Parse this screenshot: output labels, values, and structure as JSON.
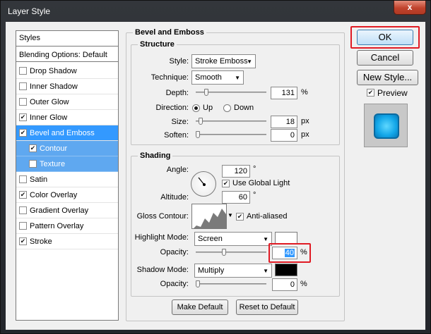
{
  "window": {
    "title": "Layer Style",
    "close_glyph": "x"
  },
  "styles_list": {
    "header": "Styles",
    "blending_options": "Blending Options: Default",
    "items": [
      {
        "label": "Drop Shadow",
        "checked": false
      },
      {
        "label": "Inner Shadow",
        "checked": false
      },
      {
        "label": "Outer Glow",
        "checked": false
      },
      {
        "label": "Inner Glow",
        "checked": true
      },
      {
        "label": "Bevel and Emboss",
        "checked": true,
        "selected": true
      },
      {
        "label": "Contour",
        "checked": true,
        "sub": true
      },
      {
        "label": "Texture",
        "checked": false,
        "sub": true
      },
      {
        "label": "Satin",
        "checked": false
      },
      {
        "label": "Color Overlay",
        "checked": true
      },
      {
        "label": "Gradient Overlay",
        "checked": false
      },
      {
        "label": "Pattern Overlay",
        "checked": false
      },
      {
        "label": "Stroke",
        "checked": true
      }
    ]
  },
  "bevel": {
    "title": "Bevel and Emboss",
    "structure": {
      "legend": "Structure",
      "style_label": "Style:",
      "style_value": "Stroke Emboss",
      "technique_label": "Technique:",
      "technique_value": "Smooth",
      "depth_label": "Depth:",
      "depth_value": "131",
      "depth_unit": "%",
      "direction_label": "Direction:",
      "direction_up": "Up",
      "direction_down": "Down",
      "size_label": "Size:",
      "size_value": "18",
      "size_unit": "px",
      "soften_label": "Soften:",
      "soften_value": "0",
      "soften_unit": "px"
    },
    "shading": {
      "legend": "Shading",
      "angle_label": "Angle:",
      "angle_value": "120",
      "angle_unit": "°",
      "global_light_label": "Use Global Light",
      "global_light_checked": true,
      "altitude_label": "Altitude:",
      "altitude_value": "60",
      "altitude_unit": "°",
      "gloss_label": "Gloss Contour:",
      "antialiased_label": "Anti-aliased",
      "antialiased_checked": true,
      "highlight_label": "Highlight Mode:",
      "highlight_value": "Screen",
      "highlight_color": "#ffffff",
      "highlight_opacity_label": "Opacity:",
      "highlight_opacity_value": "40",
      "highlight_opacity_unit": "%",
      "shadow_label": "Shadow Mode:",
      "shadow_value": "Multiply",
      "shadow_color": "#000000",
      "shadow_opacity_label": "Opacity:",
      "shadow_opacity_value": "0",
      "shadow_opacity_unit": "%"
    },
    "make_default": "Make Default",
    "reset_default": "Reset to Default"
  },
  "actions": {
    "ok": "OK",
    "cancel": "Cancel",
    "new_style": "New Style...",
    "preview_label": "Preview",
    "preview_checked": true
  }
}
